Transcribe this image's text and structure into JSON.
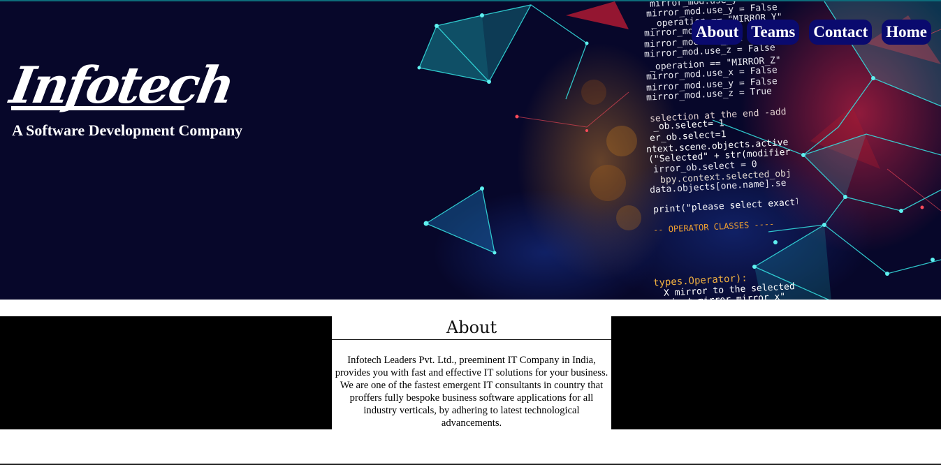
{
  "header": {
    "logo_text": "Infotech",
    "tagline": "A Software Development Company"
  },
  "nav": {
    "items": [
      "About",
      "Teams",
      "Contact",
      "Home"
    ]
  },
  "hero_code_lines": [
    "mirror_mod.use_y = True",
    "mirror_mod.use_y = False",
    "_operation == \"MIRROR_Y\"",
    "mirror_mod.use_x = False",
    "mirror_mod.use_y = True",
    "mirror_mod.use_z = False",
    "_operation == \"MIRROR_Z\"",
    "mirror_mod.use_x = False",
    "mirror_mod.use_y = False",
    "mirror_mod.use_z = True",
    "selection at the end -add",
    "_ob.select= 1",
    "er_ob.select=1",
    "ntext.scene.objects.active",
    "(\"Selected\" + str(modifier",
    "irror_ob.select = 0",
    "bpy.context.selected_obj",
    "data.objects[one.name].se",
    "print(\"please select exactly",
    "-- OPERATOR CLASSES ----",
    "types.Operator):",
    "X mirror to the selected",
    "ject.mirror_mirror_x\""
  ],
  "about": {
    "title": "About",
    "body": "Infotech Leaders Pvt. Ltd., preeminent IT Company in India, provides you with fast and effective IT solutions for your business. We are one of the fastest emergent IT consultants in country that proffers fully bespoke business software applications for all industry verticals, by adhering to latest technological advancements."
  },
  "colors": {
    "hero_bg": "#07072a",
    "nav_bg": "#0a0a6e",
    "accent_cyan": "#19e0e0",
    "accent_red": "#e0203a",
    "code_orange": "#f0a030",
    "band_black": "#000000"
  }
}
